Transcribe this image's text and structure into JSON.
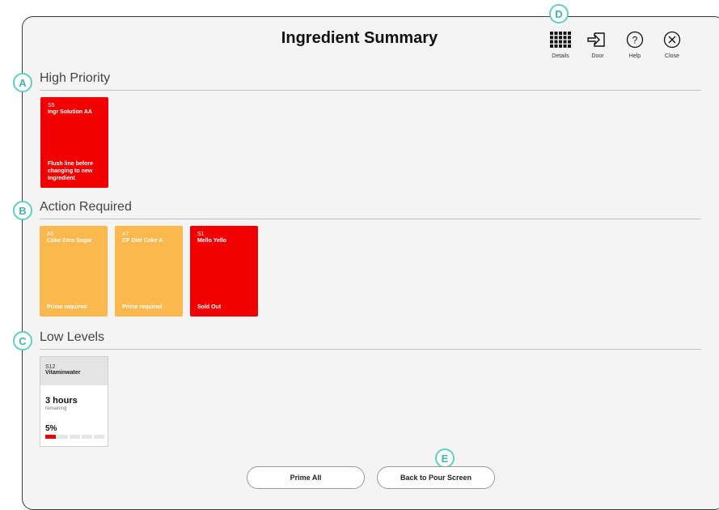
{
  "header": {
    "title": "Ingredient Summary",
    "toolbar": [
      {
        "label": "Details",
        "icon": "grid-icon"
      },
      {
        "label": "Door",
        "icon": "door-icon"
      },
      {
        "label": "Help",
        "icon": "help-icon"
      },
      {
        "label": "Close",
        "icon": "close-icon"
      }
    ]
  },
  "callouts": {
    "a": "A",
    "b": "B",
    "c": "C",
    "d": "D",
    "e": "E"
  },
  "sections": {
    "high_priority": {
      "title": "High Priority",
      "tiles": [
        {
          "slot": "S5",
          "name": "Ingr Solution AA",
          "status": "Flush line before changing to new Ingredient",
          "color": "#f00000"
        }
      ]
    },
    "action_required": {
      "title": "Action Required",
      "tiles": [
        {
          "slot": "A5",
          "name": "Coke Zero Sugar",
          "status": "Prime required",
          "color": "#fbb84c"
        },
        {
          "slot": "A7",
          "name": "CF Diet Coke A",
          "status": "Prime required",
          "color": "#fbb84c"
        },
        {
          "slot": "S1",
          "name": "Mello Yello",
          "status": "Sold Out",
          "color": "#f00000"
        }
      ]
    },
    "low_levels": {
      "title": "Low Levels",
      "cards": [
        {
          "slot": "S12",
          "name": "Vitaminwater",
          "time": "3 hours",
          "time_caption": "remaining",
          "percent": "5%",
          "level_fraction": 0.05
        }
      ]
    }
  },
  "footer": {
    "prime_all_label": "Prime All",
    "back_label": "Back to Pour Screen"
  },
  "colors": {
    "accent": "#5fcfc6",
    "alert": "#f00000",
    "warning": "#fbb84c"
  }
}
